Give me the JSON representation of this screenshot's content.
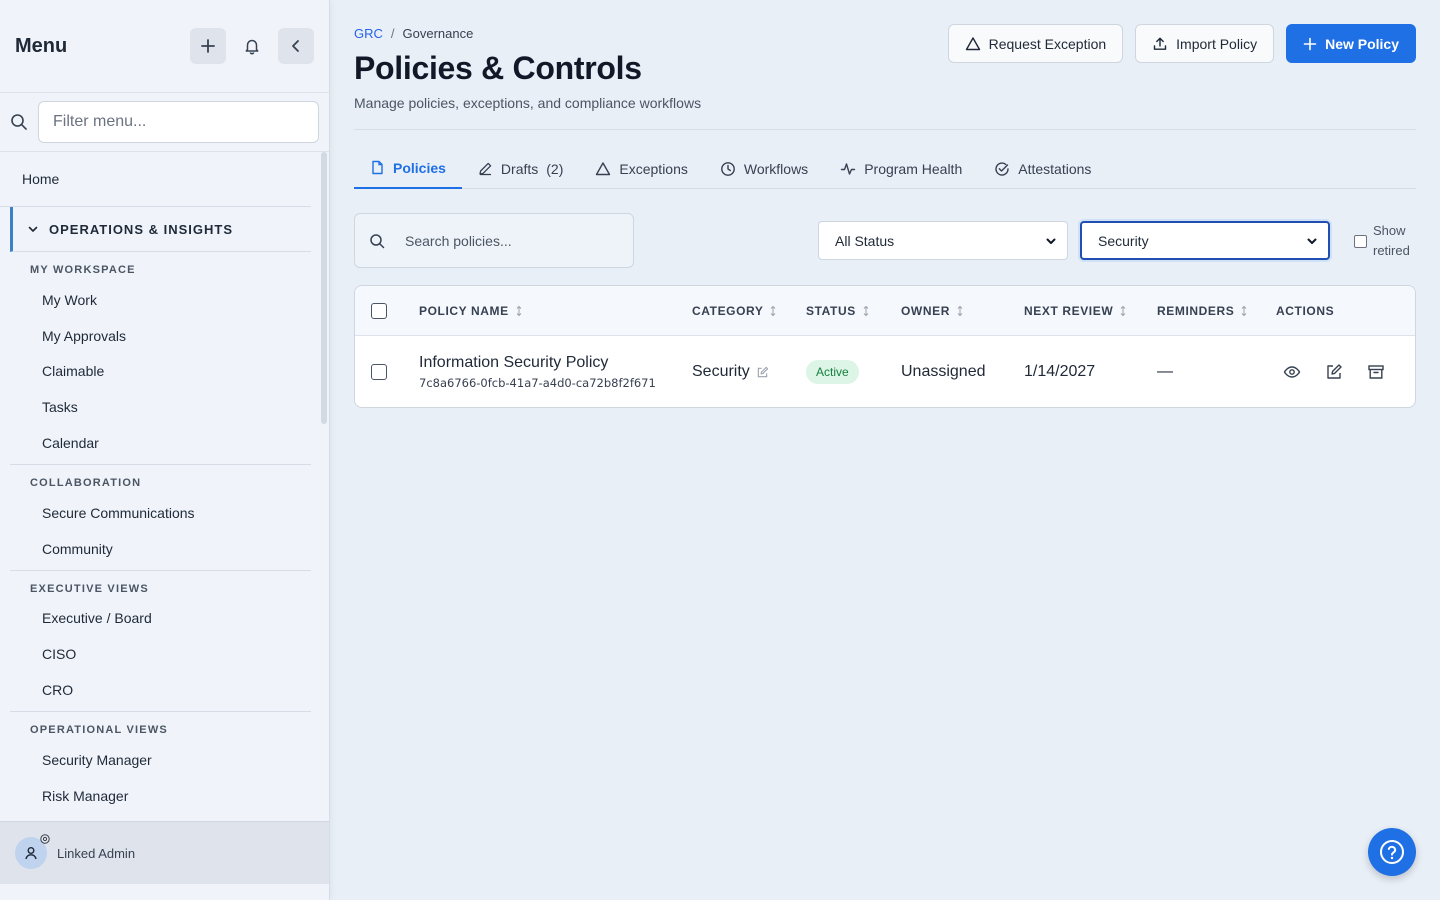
{
  "sidebar": {
    "title": "Menu",
    "filter_placeholder": "Filter menu...",
    "home": "Home",
    "section": "OPERATIONS & INSIGHTS",
    "groups": [
      {
        "title": "MY WORKSPACE",
        "items": [
          "My Work",
          "My Approvals",
          "Claimable",
          "Tasks",
          "Calendar"
        ]
      },
      {
        "title": "COLLABORATION",
        "items": [
          "Secure Communications",
          "Community"
        ]
      },
      {
        "title": "EXECUTIVE VIEWS",
        "items": [
          "Executive / Board",
          "CISO",
          "CRO"
        ]
      },
      {
        "title": "OPERATIONAL VIEWS",
        "items": [
          "Security Manager",
          "Risk Manager"
        ]
      }
    ],
    "user_name": "Linked Admin"
  },
  "header": {
    "breadcrumb_root": "GRC",
    "breadcrumb_sep": "/",
    "breadcrumb_current": "Governance",
    "title": "Policies & Controls",
    "subtitle": "Manage policies, exceptions, and compliance workflows",
    "btn_request_exception": "Request Exception",
    "btn_import_policy": "Import Policy",
    "btn_new_policy": "New Policy"
  },
  "tabs": {
    "policies": "Policies",
    "drafts": "Drafts",
    "drafts_count": "(2)",
    "exceptions": "Exceptions",
    "workflows": "Workflows",
    "program_health": "Program Health",
    "attestations": "Attestations"
  },
  "filters": {
    "search_placeholder": "Search policies...",
    "status_value": "All Status",
    "category_value": "Security",
    "show_retired": "Show retired"
  },
  "table": {
    "headers": {
      "policy_name": "POLICY NAME",
      "category": "CATEGORY",
      "status": "STATUS",
      "owner": "OWNER",
      "next_review": "NEXT REVIEW",
      "reminders": "REMINDERS",
      "actions": "ACTIONS"
    },
    "rows": [
      {
        "name": "Information Security Policy",
        "id": "7c8a6766-0fcb-41a7-a4d0-ca72b8f2f671",
        "category": "Security",
        "status": "Active",
        "owner": "Unassigned",
        "next_review": "1/14/2027",
        "reminders": "—"
      }
    ]
  },
  "colors": {
    "accent": "#1f6fe5",
    "active_badge_bg": "#dcf5e7",
    "active_badge_text": "#15803d",
    "sidebar_bg": "#f0f4fa",
    "page_bg": "#e9eff7"
  }
}
